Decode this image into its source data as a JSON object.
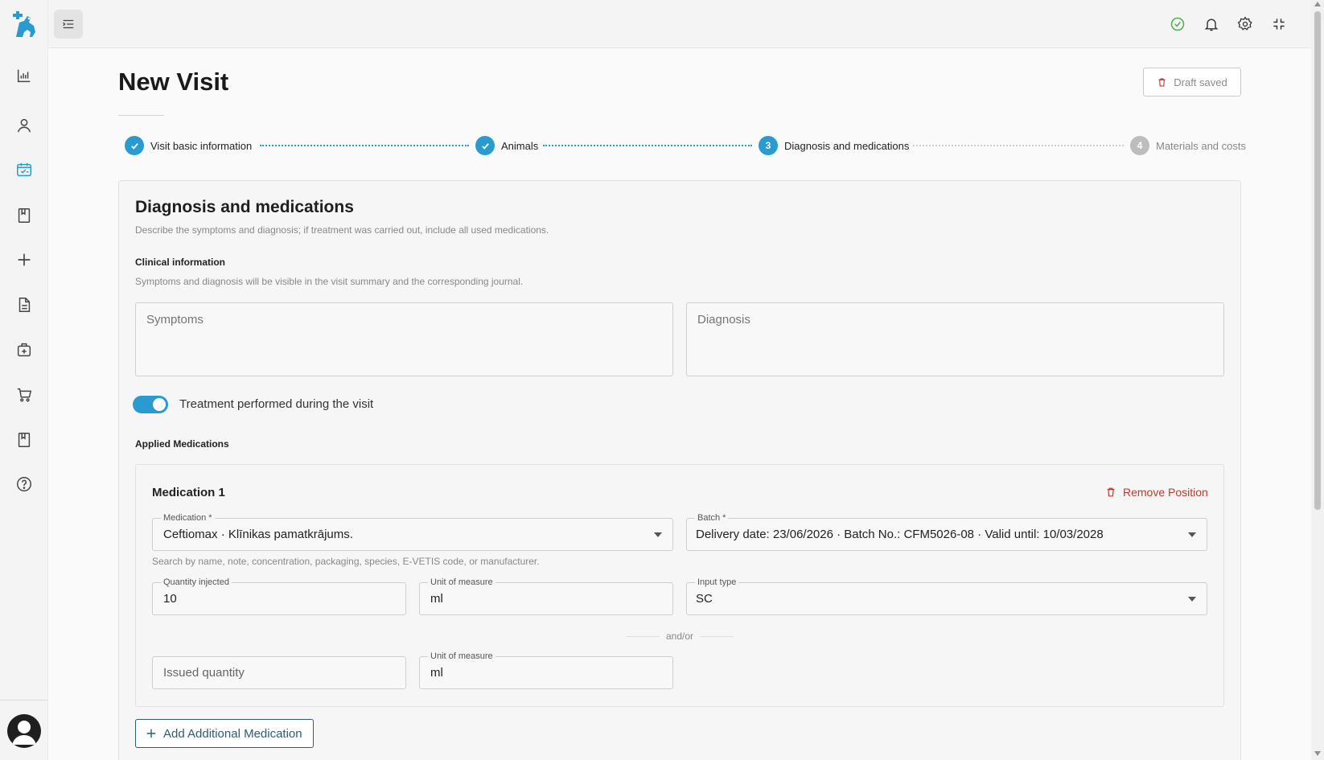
{
  "app": {
    "logo": "vet-cross-animal-logo"
  },
  "sidebar": {
    "items": [
      {
        "name": "chart-icon",
        "active": false
      },
      {
        "name": "user-icon",
        "active": false
      },
      {
        "name": "calendar-check-icon",
        "active": true
      },
      {
        "name": "bookmark-icon",
        "active": false
      },
      {
        "name": "plus-icon",
        "active": false
      },
      {
        "name": "document-icon",
        "active": false
      },
      {
        "name": "medkit-icon",
        "active": false
      },
      {
        "name": "cart-icon",
        "active": false
      },
      {
        "name": "book-icon",
        "active": false
      },
      {
        "name": "help-icon",
        "active": false
      }
    ]
  },
  "topbar": {
    "icons": [
      "check-circle-icon",
      "bell-icon",
      "gear-icon",
      "fullscreen-exit-icon"
    ]
  },
  "page": {
    "title": "New Visit",
    "draft_label": "Draft saved"
  },
  "stepper": {
    "steps": [
      {
        "label": "Visit basic information",
        "state": "done",
        "number": "1"
      },
      {
        "label": "Animals",
        "state": "done",
        "number": "2"
      },
      {
        "label": "Diagnosis and medications",
        "state": "active",
        "number": "3"
      },
      {
        "label": "Materials and costs",
        "state": "pending",
        "number": "4"
      }
    ]
  },
  "card": {
    "title": "Diagnosis and medications",
    "description": "Describe the symptoms and diagnosis; if treatment was carried out, include all used medications.",
    "clinical": {
      "title": "Clinical information",
      "description": "Symptoms and diagnosis will be visible in the visit summary and the corresponding journal.",
      "symptoms_placeholder": "Symptoms",
      "diagnosis_placeholder": "Diagnosis"
    },
    "treatment_toggle": {
      "label": "Treatment performed during the visit",
      "on": true
    },
    "applied_title": "Applied Medications",
    "medication": {
      "title": "Medication 1",
      "remove_label": "Remove Position",
      "medication_label": "Medication *",
      "medication_value": "Ceftiomax · Klīnikas pamatkrājums.",
      "batch_label": "Batch *",
      "batch_value": "Delivery date: 23/06/2026 · Batch No.: CFM5026-08 · Valid until: 10/03/2028",
      "help": "Search by name, note, concentration, packaging, species, E-VETIS code, or manufacturer.",
      "quantity_injected_label": "Quantity injected",
      "quantity_injected_value": "10",
      "unit_label": "Unit of measure",
      "unit_value": "ml",
      "input_type_label": "Input type",
      "input_type_value": "SC",
      "andor": "and/or",
      "issued_placeholder": "Issued quantity",
      "unit2_label": "Unit of measure",
      "unit2_value": "ml"
    },
    "add_button": "Add Additional Medication"
  },
  "colors": {
    "accent": "#2a9bd0",
    "success": "#4caf50",
    "danger": "#c0392b",
    "pending": "#bdbdbd",
    "add_button": "#2b5d73"
  }
}
